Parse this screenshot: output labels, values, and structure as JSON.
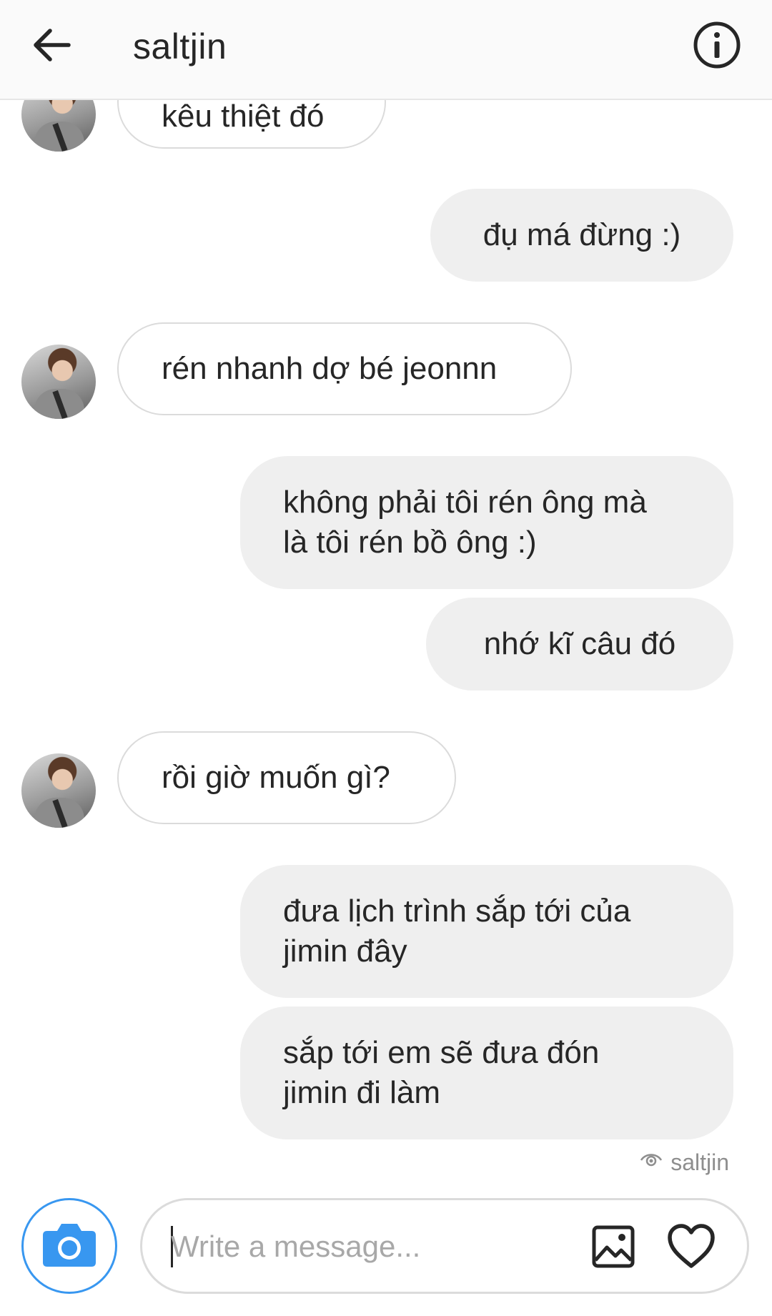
{
  "header": {
    "title": "saltjin",
    "back_icon": "arrow-left-icon",
    "info_icon": "info-circle-icon"
  },
  "messages": [
    {
      "from": "them",
      "text": "kêu thiệt đó"
    },
    {
      "from": "me",
      "text": "đụ má đừng :)"
    },
    {
      "from": "them",
      "text": "rén nhanh dợ bé jeonnn"
    },
    {
      "from": "me",
      "text": "không phải tôi rén ông mà\nlà tôi rén bồ ông :)"
    },
    {
      "from": "me",
      "text": "nhớ kĩ câu đó"
    },
    {
      "from": "them",
      "text": "rồi giờ muốn gì?"
    },
    {
      "from": "me",
      "text": "đưa lịch trình sắp tới của\njimin đây"
    },
    {
      "from": "me",
      "text": "sắp tới em sẽ đưa đón\njimin đi làm"
    }
  ],
  "seen": {
    "icon": "eye-icon",
    "label": "saltjin"
  },
  "composer": {
    "placeholder": "Write a message...",
    "value": "",
    "camera_icon": "camera-icon",
    "gallery_icon": "image-icon",
    "heart_icon": "heart-icon"
  },
  "colors": {
    "accent": "#3897f0",
    "outgoing_bubble": "#efefef",
    "incoming_border": "#dbdbdb",
    "text": "#262626",
    "muted": "#8e8e8e"
  }
}
